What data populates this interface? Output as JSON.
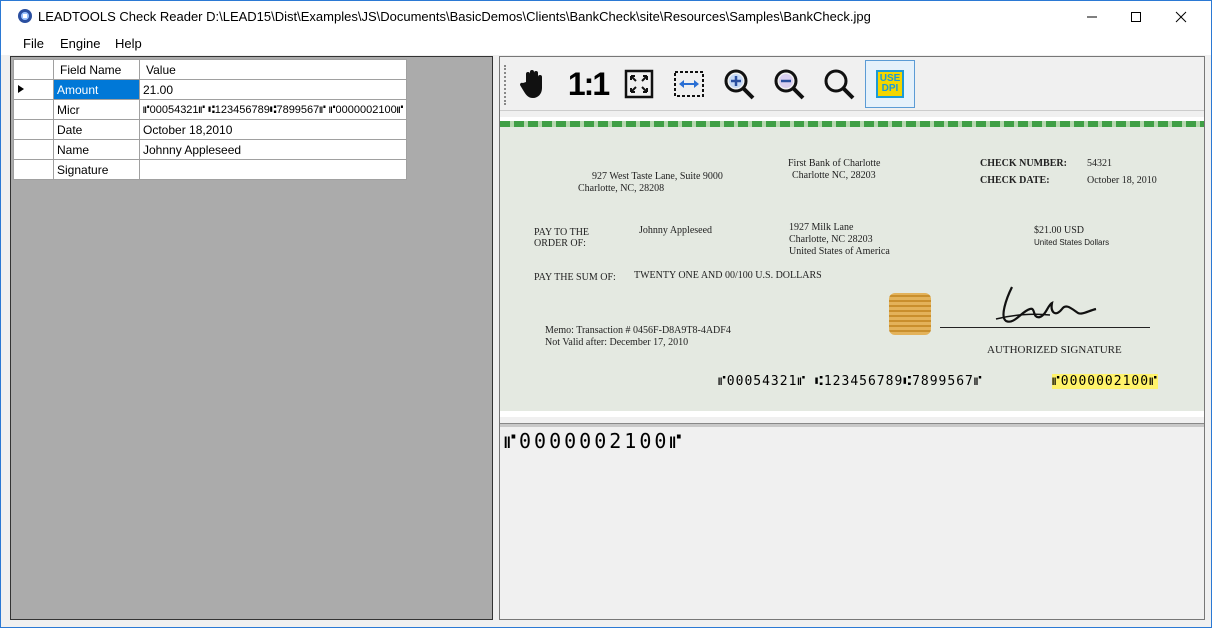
{
  "window": {
    "title": "LEADTOOLS Check Reader D:\\LEAD15\\Dist\\Examples\\JS\\Documents\\BasicDemos\\Clients\\BankCheck\\site\\Resources\\Samples\\BankCheck.jpg",
    "minimize": "—",
    "maximize": "☐",
    "close": "✕"
  },
  "menu": {
    "file": "File",
    "engine": "Engine",
    "help": "Help"
  },
  "grid": {
    "headers": {
      "field": "Field Name",
      "value": "Value"
    },
    "rows": [
      {
        "field": "Amount",
        "value": "21.00"
      },
      {
        "field": "Micr",
        "value": "⑈00054321⑈ ⑆123456789⑆7899567⑈ ⑈0000002100⑈"
      },
      {
        "field": "Date",
        "value": "October 18,2010"
      },
      {
        "field": "Name",
        "value": "Johnny Appleseed"
      },
      {
        "field": "Signature",
        "value": ""
      }
    ]
  },
  "toolbar": {
    "one_to_one": "1:1",
    "use_dpi_line1": "USE",
    "use_dpi_line2": "DPI"
  },
  "check": {
    "address1": "927 West Taste Lane, Suite 9000",
    "address2": "Charlotte, NC, 28208",
    "bank1": "First Bank of Charlotte",
    "bank2": "Charlotte NC, 28203",
    "check_number_label": "CHECK NUMBER:",
    "check_number": "54321",
    "check_date_label": "CHECK DATE:",
    "check_date": "October 18, 2010",
    "pay_to_label1": "PAY TO THE",
    "pay_to_label2": "ORDER OF:",
    "payee": "Johnny Appleseed",
    "payee_addr1": "1927 Milk Lane",
    "payee_addr2": "Charlotte, NC 28203",
    "payee_addr3": "United States of America",
    "amount_num": "$21.00 USD",
    "amount_currency": "United States Dollars",
    "pay_sum_label": "PAY THE SUM OF:",
    "pay_sum_words": "TWENTY ONE  AND 00/100 U.S. DOLLARS",
    "memo1": "Memo: Transaction # 0456F-D8A9T8-4ADF4",
    "memo2": "Not Valid after: December 17, 2010",
    "authorized": "AUTHORIZED SIGNATURE",
    "micr_line": "⑈00054321⑈ ⑆123456789⑆7899567⑈",
    "micr_amount": "⑈0000002100⑈"
  },
  "zoom_view": {
    "micr_amount": "⑈0000002100⑈"
  },
  "colors": {
    "selection": "#0078d7",
    "highlight": "#fff36b",
    "accent_border": "#2b79d4"
  }
}
